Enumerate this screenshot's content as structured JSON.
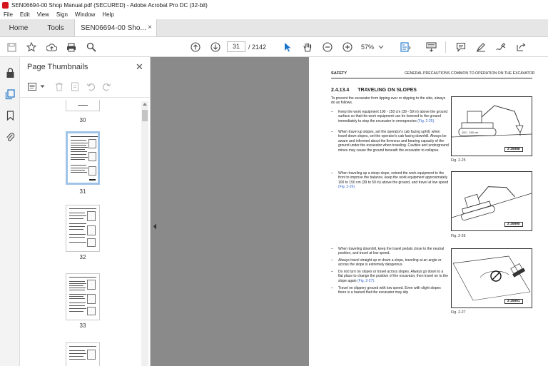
{
  "window": {
    "title": "SEN06694-00 Shop Manual.pdf (SECURED) - Adobe Acrobat Pro DC (32-bit)"
  },
  "menu": [
    "File",
    "Edit",
    "View",
    "Sign",
    "Window",
    "Help"
  ],
  "tabs": {
    "home": "Home",
    "tools": "Tools",
    "document": "SEN06694-00 Sho...",
    "close_glyph": "×"
  },
  "toolbar": {
    "current_page": "31",
    "page_total": "/ 2142",
    "zoom": "57%",
    "icons": [
      "save-icon",
      "bookmark-star-icon",
      "upload-icon",
      "print-icon",
      "search-icon",
      "page-up-icon",
      "page-down-icon",
      "select-arrow-icon",
      "hand-icon",
      "zoom-out-icon",
      "zoom-in-icon",
      "fit-page-icon",
      "keyboard-icon",
      "comment-icon",
      "highlight-icon",
      "sign-icon",
      "share-icon"
    ]
  },
  "thumbnails_panel": {
    "title": "Page Thumbnails",
    "close_glyph": "✕",
    "pages": [
      {
        "label": "30",
        "selected": false
      },
      {
        "label": "31",
        "selected": true
      },
      {
        "label": "32",
        "selected": false
      },
      {
        "label": "33",
        "selected": false
      },
      {
        "label": "",
        "selected": false
      }
    ]
  },
  "page": {
    "header_left": "SAFETY",
    "header_right": "GENERAL PRECAUTIONS COMMON TO OPERATION ON THE EXCAVATOR",
    "section_number": "2.4.13.4",
    "section_title": "TRAVELING ON SLOPES",
    "intro": "To prevent the excavator from tipping over or slipping to the side, always do as follows.",
    "bullets": [
      {
        "dash": "–",
        "text": "Keep the work equipment 100 - 150 cm (39 - 59 in) above the ground surface so that the work equipment can be lowered to the ground immediately to stop the excavator in emergencies",
        "ref": "(Fig. 2-25)."
      },
      {
        "dash": "–",
        "text": "When travel up slopes, set the operator's cab facing uphill, when travel down slopes, set the operator's cab facing downhill. Always be aware and informed about the firmness and bearing capacity of the ground under the excavator when traveling. Cavities and underground mines may cause the ground beneath the excavator to collapse.",
        "ref": ""
      },
      {
        "dash": "–",
        "text": "When traveling up a steep slope, extend the work equipment to the front to improve the balance, keep the work equipment approximately 100 to 150 cm (39 to 59 in) above the ground, and travel at low speed",
        "ref": "(Fig. 2-26)."
      },
      {
        "dash": "–",
        "text": "When traveling downhill, keep the travel pedals close to the neutral position, and travel at low speed.",
        "ref": ""
      },
      {
        "dash": "–",
        "text": "Always travel straight up or down a slope, traveling at an angle or across the slope is extremely dangerous.",
        "ref": ""
      },
      {
        "dash": "–",
        "text": "Do not turn on slopes or travel across slopes. Always go down to a flat place to change the position of the excavator, then travel on to the slope again",
        "ref": "(Fig. 2-27)."
      },
      {
        "dash": "–",
        "text": "Travel on slippery ground with low speed. Even with slight slopes there is a hazard that the excavator may slip",
        "ref": ""
      }
    ],
    "figures": [
      {
        "code": "Z 25988",
        "caption": "Fig. 2-25",
        "dimension": "100 - 150 cm"
      },
      {
        "code": "Z 25990",
        "caption": "Fig. 2-26"
      },
      {
        "code": "Z 25991",
        "caption": "Fig. 2-27"
      }
    ]
  }
}
